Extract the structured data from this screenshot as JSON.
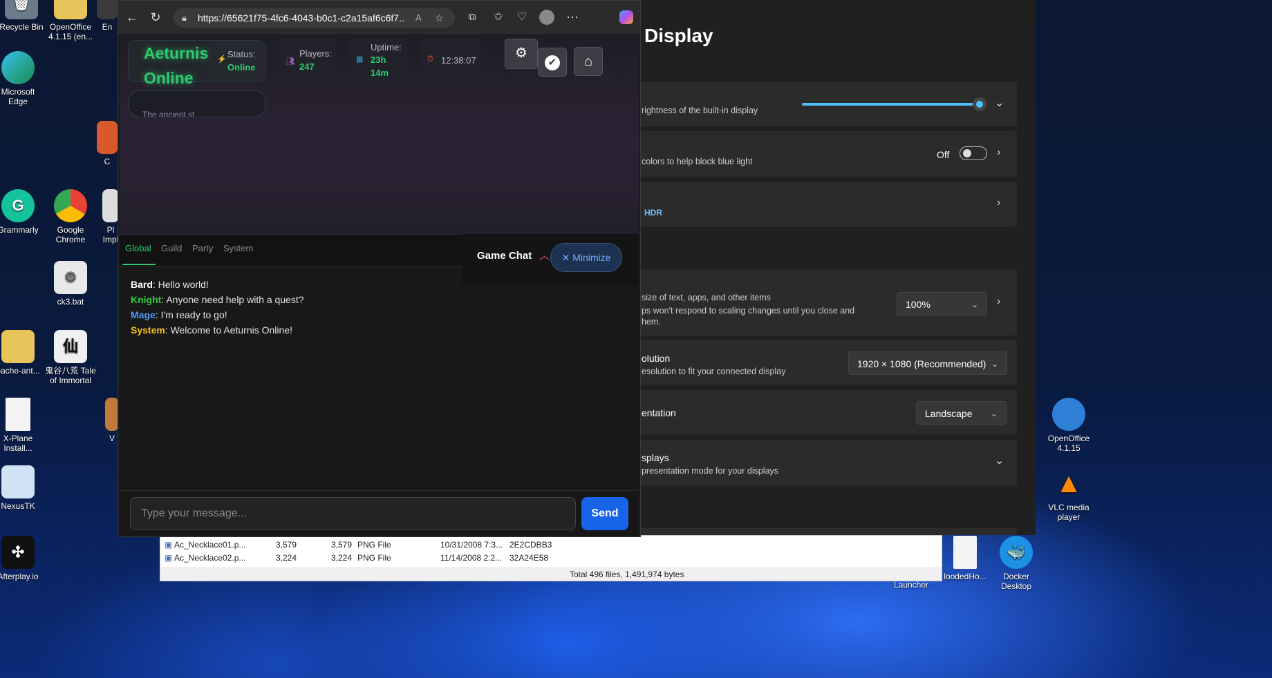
{
  "desktop": {
    "icons_left": [
      {
        "label": "Recycle Bin"
      },
      {
        "label": "OpenOffice 4.1.15 (en..."
      },
      {
        "label": "En"
      },
      {
        "label": "Microsoft Edge"
      },
      {
        "label": "C"
      },
      {
        "label": "Grammarly"
      },
      {
        "label": "Google Chrome"
      },
      {
        "label": "Pl Impl"
      },
      {
        "label": "ck3.bat"
      },
      {
        "label": "pache-ant..."
      },
      {
        "label": "鬼谷八荒 Tale of Immortal"
      },
      {
        "label": "X-Plane Install..."
      },
      {
        "label": "V"
      },
      {
        "label": "NexusTK"
      },
      {
        "label": "Afterplay.io"
      }
    ],
    "icons_right": [
      {
        "label": "OpenOffice 4.1.15"
      },
      {
        "label": "VLC media player"
      },
      {
        "label": "Launcher"
      },
      {
        "label": "loodedHo..."
      },
      {
        "label": "Docker Desktop"
      }
    ]
  },
  "browser": {
    "url": "https://65621f75-4fc6-4043-b0c1-c2a15af6c6f7..."
  },
  "game": {
    "brand": "Aeturnis Online",
    "status_label": "Status:",
    "status_value": "Online",
    "players_label": "Players:",
    "players_value": "247",
    "uptime_label": "Uptime:",
    "uptime_value_h": "23h",
    "uptime_value_m": "14m",
    "clock": "12:38:07",
    "ticker": "The ancient st",
    "tabs": [
      "Global",
      "Guild",
      "Party",
      "System"
    ],
    "chat_title": "Game Chat",
    "minimize_label": "Minimize",
    "messages": [
      {
        "who": "Bard",
        "text": ": Hello world!",
        "color": "#ffffff"
      },
      {
        "who": "Knight",
        "text": ": Anyone need help with a quest?",
        "color": "#2ecc40"
      },
      {
        "who": "Mage",
        "text": ": I'm ready to go!",
        "color": "#4a9eff"
      },
      {
        "who": "System",
        "text": ": Welcome to Aeturnis Online!",
        "color": "#f5c518"
      }
    ],
    "input_placeholder": "Type your message...",
    "send_label": "Send"
  },
  "settings": {
    "title": "Display",
    "brightness_desc": "rightness of the built-in display",
    "night_light_desc": "colors to help block blue light",
    "night_light_state": "Off",
    "hdr_label": "HDR",
    "scale_desc1": "size of text, apps, and other items",
    "scale_desc2": "ps won't respond to scaling changes until you close and",
    "scale_desc3": "hem.",
    "scale_value": "100%",
    "resolution_label": "olution",
    "resolution_desc": "esolution to fit your connected display",
    "resolution_value": "1920 × 1080 (Recommended)",
    "orientation_label": "entation",
    "orientation_value": "Landscape",
    "multiple_label": "splays",
    "multiple_desc": "presentation mode for your displays",
    "brightness_level": 0.98
  },
  "explorer": {
    "rows": [
      {
        "name": "Ac_Necklace01.p...",
        "size1": "3,579",
        "size2": "3,579",
        "type": "PNG File",
        "date": "10/31/2008 7:3...",
        "crc": "2E2CDBB3"
      },
      {
        "name": "Ac_Necklace02.p...",
        "size1": "3,224",
        "size2": "3,224",
        "type": "PNG File",
        "date": "11/14/2008 2:2...",
        "crc": "32A24E58"
      }
    ],
    "status": "Total 496 files, 1,491,974 bytes"
  },
  "colors": {
    "accent_green": "#2ecc71",
    "send_blue": "#1864e8"
  }
}
